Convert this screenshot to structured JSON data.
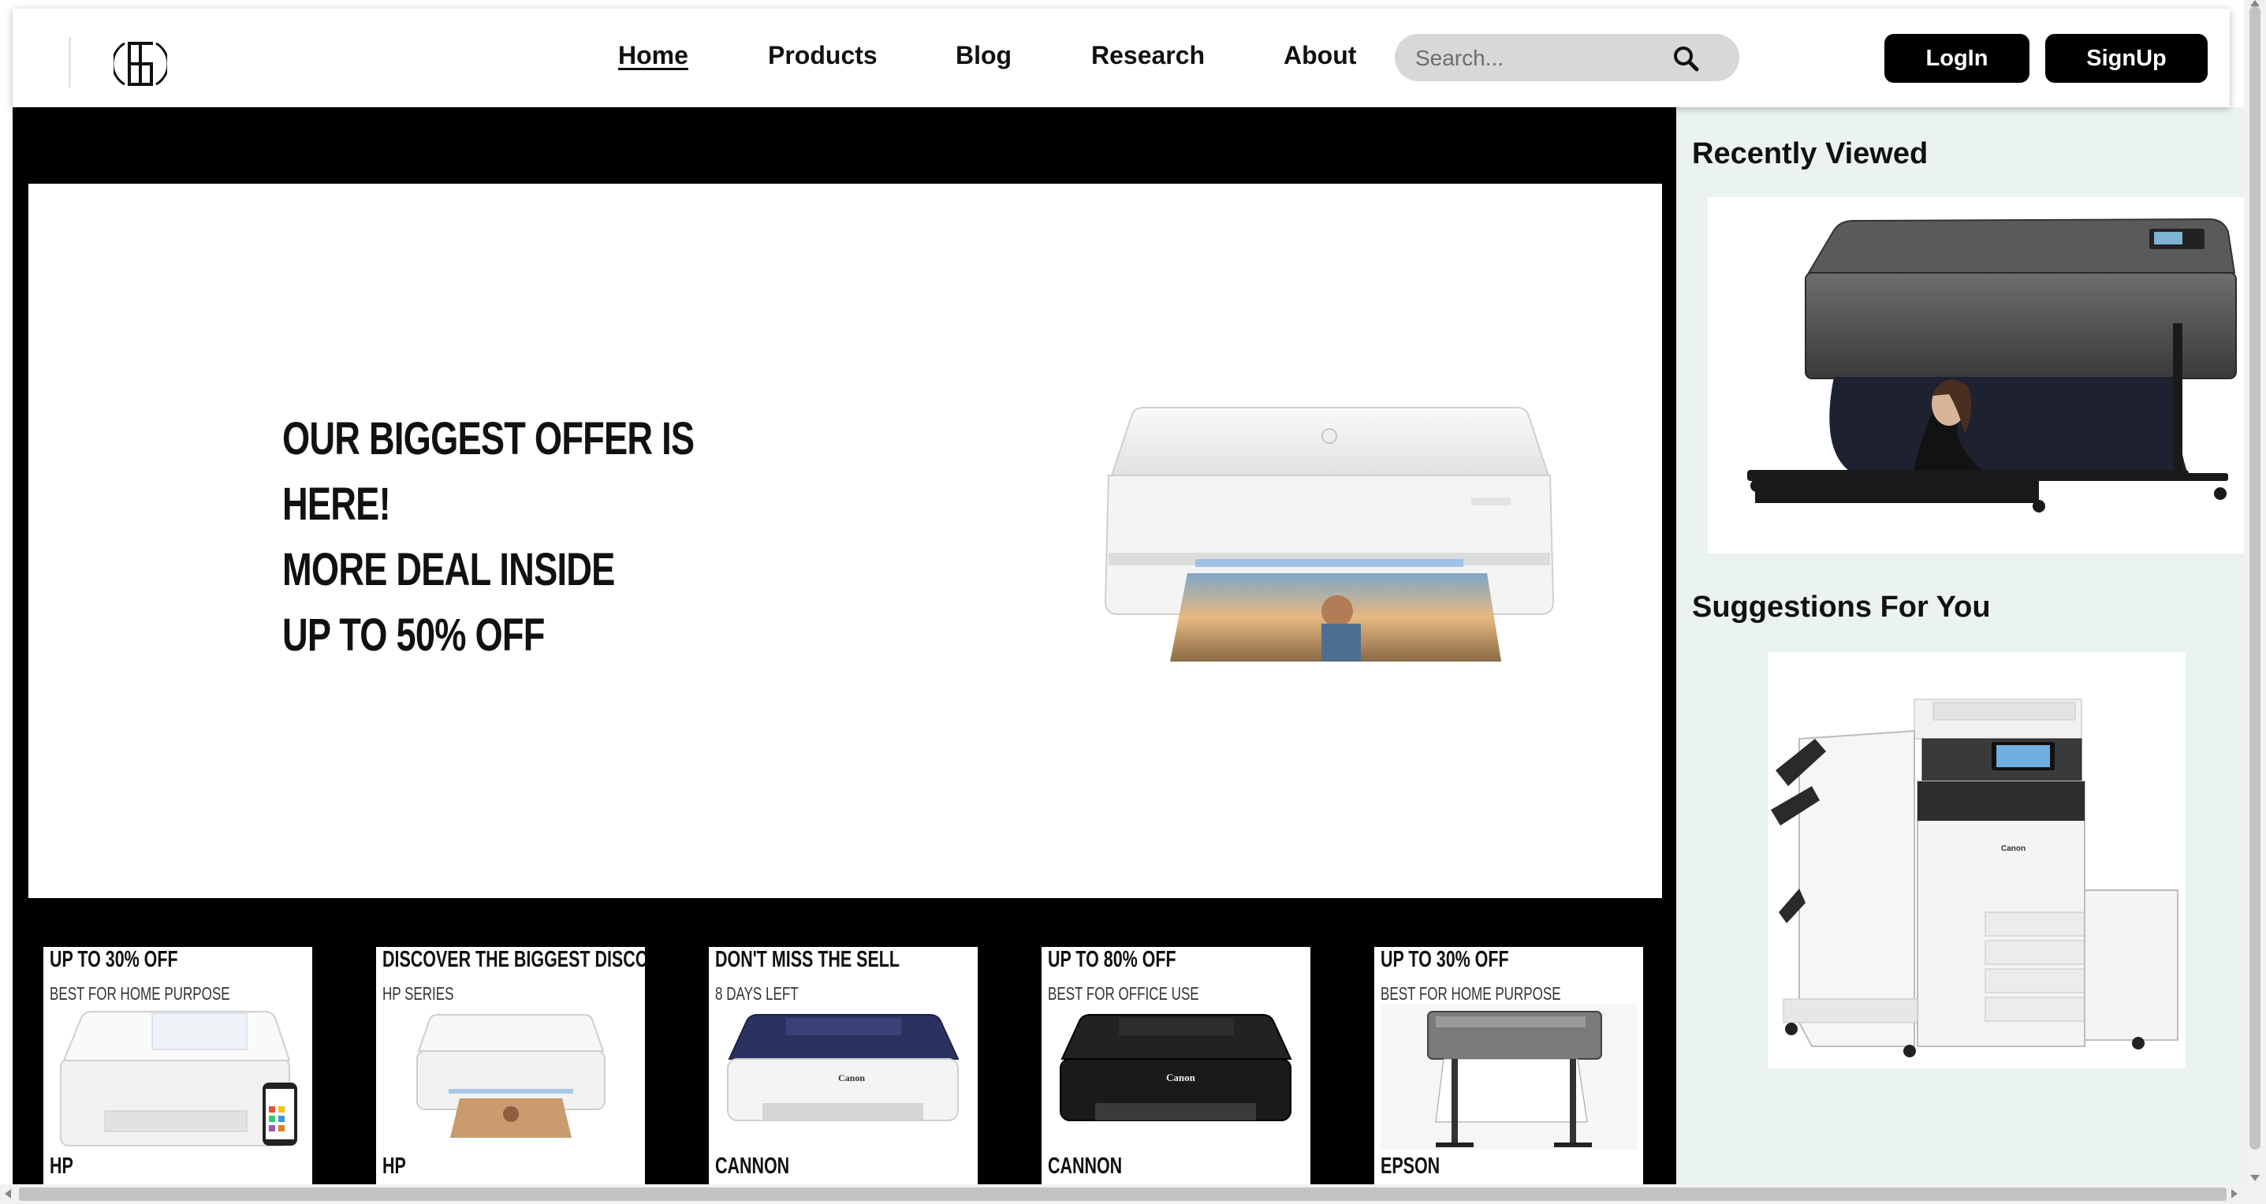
{
  "header": {
    "logo_icon": "monogram-logo-icon",
    "nav": [
      {
        "label": "Home",
        "active": true
      },
      {
        "label": "Products",
        "active": false
      },
      {
        "label": "Blog",
        "active": false
      },
      {
        "label": "Research",
        "active": false
      },
      {
        "label": "About",
        "active": false
      }
    ],
    "search": {
      "placeholder": "Search...",
      "icon": "search-icon"
    },
    "login_label": "LogIn",
    "signup_label": "SignUp"
  },
  "hero": {
    "lines": [
      "Our biggest offer is",
      "here!",
      "More deal inside",
      "Up to 50% off"
    ],
    "image": "white-inkjet-printer-with-photo"
  },
  "offers": [
    {
      "title": "Up to 30% off",
      "subtitle": "Best for home purpose",
      "brand": "HP",
      "image": "white-all-in-one-printer"
    },
    {
      "title": "Discover the biggest discount",
      "subtitle": "HP Series",
      "brand": "HP",
      "image": "white-inkjet-printer"
    },
    {
      "title": "Don't miss the sell",
      "subtitle": "8 days left",
      "brand": "Cannon",
      "image": "navy-inkjet-printer"
    },
    {
      "title": "Up to 80% off",
      "subtitle": "Best for office use",
      "brand": "Cannon",
      "image": "black-inkjet-printer"
    },
    {
      "title": "Up to 30% off",
      "subtitle": "Best for home purpose",
      "brand": "Epson",
      "image": "large-format-printer"
    }
  ],
  "sidebar": {
    "recently_viewed_title": "Recently Viewed",
    "recently_viewed_image": "large-format-photo-printer",
    "suggestions_title": "Suggestions For You",
    "suggestions_image": "office-multifunction-copier"
  },
  "colors": {
    "accent": "#000000",
    "sidebar_bg": "#ebf3f1",
    "search_bg": "#d8d8d8"
  }
}
